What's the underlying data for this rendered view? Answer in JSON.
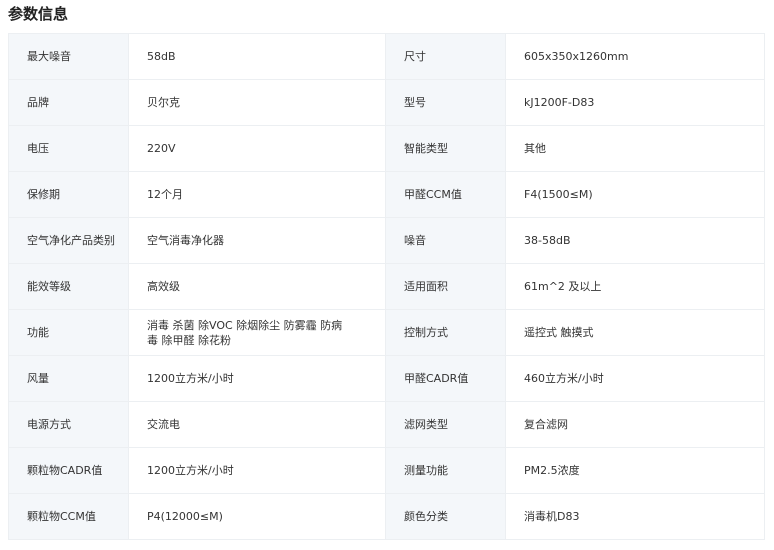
{
  "section": {
    "title": "参数信息"
  },
  "rows": [
    {
      "l_label": "最大噪音",
      "l_value": "58dB",
      "r_label": "尺寸",
      "r_value": "605x350x1260mm"
    },
    {
      "l_label": "品牌",
      "l_value": "贝尔克",
      "r_label": "型号",
      "r_value": "kJ1200F-D83"
    },
    {
      "l_label": "电压",
      "l_value": "220V",
      "r_label": "智能类型",
      "r_value": "其他"
    },
    {
      "l_label": "保修期",
      "l_value": "12个月",
      "r_label": "甲醛CCM值",
      "r_value": "F4(1500≤M)"
    },
    {
      "l_label": "空气净化产品类别",
      "l_value": "空气消毒净化器",
      "r_label": "噪音",
      "r_value": "38-58dB"
    },
    {
      "l_label": "能效等级",
      "l_value": "高效级",
      "r_label": "适用面积",
      "r_value": "61m^2 及以上"
    },
    {
      "l_label": "功能",
      "l_value": "消毒 杀菌 除VOC 除烟除尘 防雾霾 防病毒 除甲醛 除花粉",
      "r_label": "控制方式",
      "r_value": "遥控式 触摸式"
    },
    {
      "l_label": "风量",
      "l_value": "1200立方米/小时",
      "r_label": "甲醛CADR值",
      "r_value": "460立方米/小时"
    },
    {
      "l_label": "电源方式",
      "l_value": "交流电",
      "r_label": "滤网类型",
      "r_value": "复合滤网"
    },
    {
      "l_label": "颗粒物CADR值",
      "l_value": "1200立方米/小时",
      "r_label": "测量功能",
      "r_value": "PM2.5浓度"
    },
    {
      "l_label": "颗粒物CCM值",
      "l_value": "P4(12000≤M)",
      "r_label": "颜色分类",
      "r_value": "消毒机D83"
    }
  ]
}
